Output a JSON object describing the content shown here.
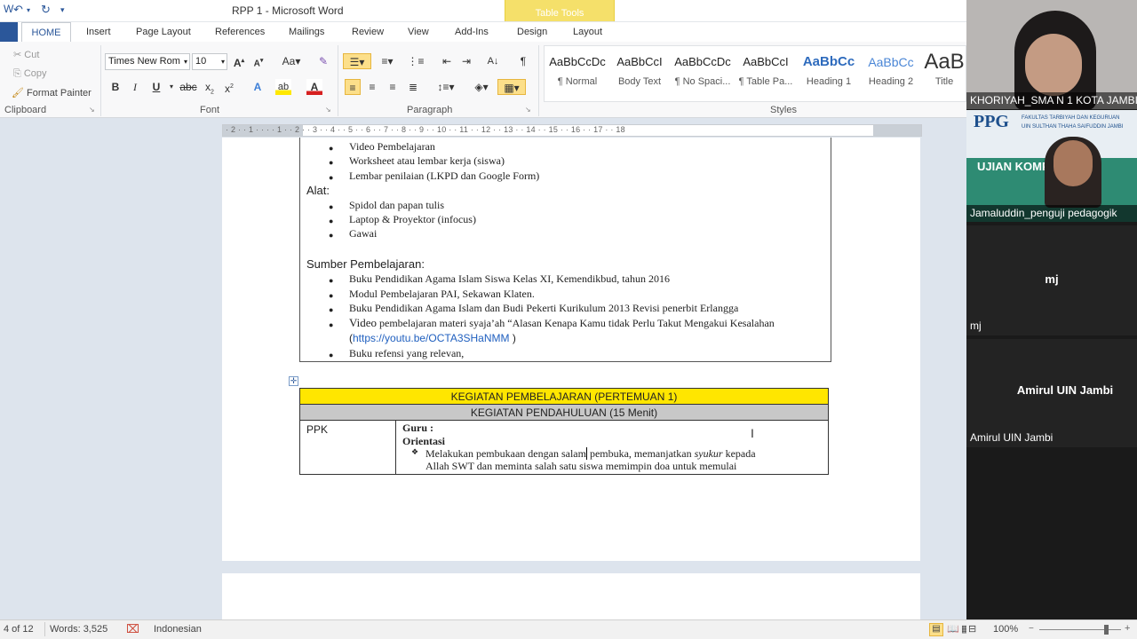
{
  "window": {
    "title": "RPP 1  -  Microsoft Word",
    "context_tab": "Table Tools"
  },
  "tabs": [
    "HOME",
    "Insert",
    "Page Layout",
    "References",
    "Mailings",
    "Review",
    "View",
    "Add-Ins",
    "Design",
    "Layout"
  ],
  "clipboard": {
    "cut": "Cut",
    "copy": "Copy",
    "format_painter": "Format Painter",
    "label": "Clipboard"
  },
  "font": {
    "name": "Times New Rom",
    "size": "10",
    "label": "Font"
  },
  "paragraph": {
    "label": "Paragraph"
  },
  "styles": {
    "label": "Styles",
    "items": [
      {
        "sample": "AaBbCcDc",
        "name": "¶ Normal"
      },
      {
        "sample": "AaBbCcI",
        "name": "Body Text"
      },
      {
        "sample": "AaBbCcDc",
        "name": "¶ No Spaci..."
      },
      {
        "sample": "AaBbCcI",
        "name": "¶ Table Pa..."
      },
      {
        "sample": "AaBbCc",
        "name": "Heading 1"
      },
      {
        "sample": "AaBbCc",
        "name": "Heading 2"
      },
      {
        "sample": "AaB",
        "name": "Title"
      }
    ]
  },
  "ruler": "· 2 · · 1 · · · · 1 · · 2 · · 3 · · 4 · · 5 · · 6 · · 7 · · 8 · · 9 · · 10 · · 11 · · 12 · · 13 · · 14 · · 15 · · 16 · · 17 · · 18",
  "doc": {
    "media_items": [
      "Video Pembelajaran",
      "Worksheet atau lembar kerja (siswa)",
      "Lembar penilaian (LKPD  dan Google  Form)"
    ],
    "alat_label": "Alat:",
    "alat_items": [
      "Spidol dan papan tulis",
      "Laptop & Proyektor (infocus)",
      "Gawai"
    ],
    "sumber_label": "Sumber Pembelajaran:",
    "sumber_items": [
      "Buku Pendidikan Agama Islam Siswa  Kelas XI,  Kemendikbud, tahun 2016",
      "Modul Pembelajaran PAI, Sekawan Klaten.",
      "Buku Pendidikan Agama Islam dan Budi Pekerti Kurikulum 2013 Revisi  penerbit Erlangga"
    ],
    "video_prefix": "Video",
    "video_text": " pembelajaran materi syaja’ah “Alasan Kenapa Kamu tidak Perlu Takut Mengakui Kesalahan",
    "link_open": "(",
    "link": "https://youtu.be/OCTA3SHaNMM",
    "link_close": " )",
    "last_item": "Buku refensi  yang relevan,",
    "table": {
      "header1": "KEGIATAN PEMBELAJARAN (PERTEMUAN 1)",
      "header2": "KEGIATAN PENDAHULUAN (15 Menit)",
      "left": "PPK",
      "guru": "Guru :",
      "orientasi": "Orientasi",
      "line1a": "Melakukan pembukaan dengan salam",
      "line1b": " pembuka, memanjatkan ",
      "line1c": "syukur",
      "line1d": " kepada",
      "line2": "Allah SWT  dan meminta salah satu siswa  memimpin doa  untuk  memulai"
    }
  },
  "status": {
    "page": "4 of 12",
    "words": "Words: 3,525",
    "language": "Indonesian",
    "zoom": "100%"
  },
  "participants": [
    {
      "name": "KHORIYAH_SMA N 1 KOTA JAMBI"
    },
    {
      "name": "Jamaluddin_penguji pedagogik",
      "banner_title": "PPG",
      "banner_sub1": "FAKULTAS TARBIYAH DAN KEGURUAN",
      "banner_sub2": "UIN SULTHAN THAHA SAIFUDDIN JAMBI",
      "banner_main": "UJIAN KOMPETENSI"
    },
    {
      "name": "mj",
      "center": "mj"
    },
    {
      "name": "Amirul UIN Jambi",
      "center": "Amirul UIN Jambi"
    }
  ],
  "colors": {
    "word_blue": "#2b579a",
    "table_header_yellow": "#ffe600",
    "table_sub_gray": "#c8c8c8",
    "table_tools": "#f5e06a"
  }
}
